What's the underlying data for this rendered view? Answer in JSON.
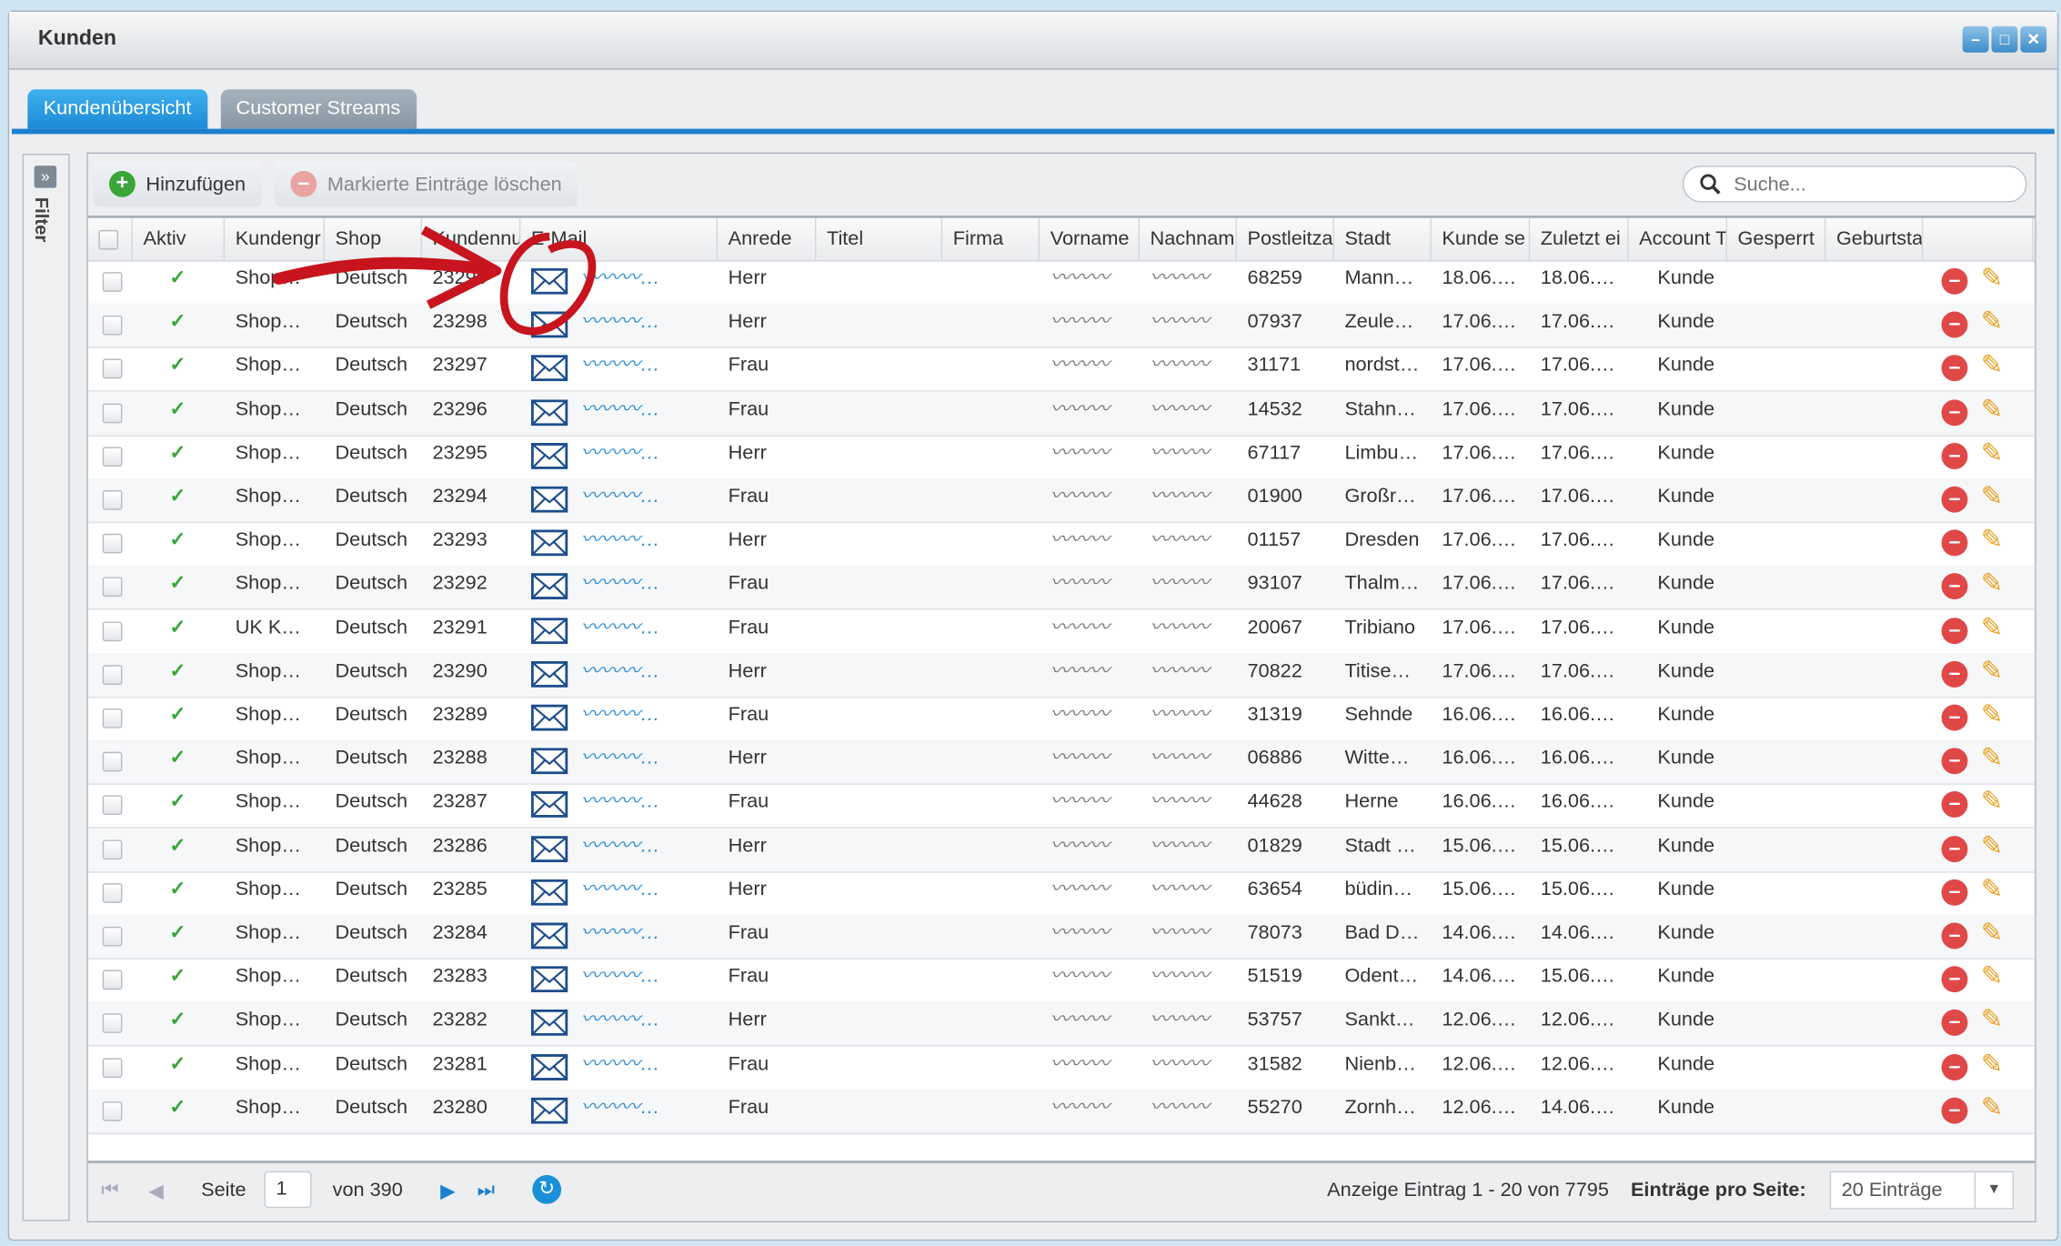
{
  "window": {
    "title": "Kunden",
    "buttons": [
      "minimize",
      "maximize",
      "close"
    ]
  },
  "tabs": [
    {
      "label": "Kundenübersicht",
      "active": true
    },
    {
      "label": "Customer Streams",
      "active": false
    }
  ],
  "filter": {
    "label": "Filter"
  },
  "toolbar": {
    "add_label": "Hinzufügen",
    "delete_label": "Markierte Einträge löschen",
    "search_placeholder": "Suche..."
  },
  "columns": [
    "",
    "Aktiv",
    "Kundengr",
    "Shop",
    "Kundennu",
    "E-Mail",
    "Anrede",
    "Titel",
    "Firma",
    "Vorname",
    "Nachnam",
    "Postleitza",
    "Stadt",
    "Kunde se",
    "Zuletzt ei",
    "Account T",
    "Gesperrt",
    "Geburtsta",
    ""
  ],
  "rows": [
    {
      "group": "Shop…",
      "shop": "Deutsch",
      "nr": "23299",
      "anrede": "Herr",
      "plz": "68259",
      "stadt": "Mann…",
      "seit": "18.06.…",
      "zuletzt": "18.06.…",
      "account": "Kunde"
    },
    {
      "group": "Shop…",
      "shop": "Deutsch",
      "nr": "23298",
      "anrede": "Herr",
      "plz": "07937",
      "stadt": "Zeule…",
      "seit": "17.06.…",
      "zuletzt": "17.06.…",
      "account": "Kunde"
    },
    {
      "group": "Shop…",
      "shop": "Deutsch",
      "nr": "23297",
      "anrede": "Frau",
      "plz": "31171",
      "stadt": "nordst…",
      "seit": "17.06.…",
      "zuletzt": "17.06.…",
      "account": "Kunde"
    },
    {
      "group": "Shop…",
      "shop": "Deutsch",
      "nr": "23296",
      "anrede": "Frau",
      "plz": "14532",
      "stadt": "Stahn…",
      "seit": "17.06.…",
      "zuletzt": "17.06.…",
      "account": "Kunde"
    },
    {
      "group": "Shop…",
      "shop": "Deutsch",
      "nr": "23295",
      "anrede": "Herr",
      "plz": "67117",
      "stadt": "Limbu…",
      "seit": "17.06.…",
      "zuletzt": "17.06.…",
      "account": "Kunde"
    },
    {
      "group": "Shop…",
      "shop": "Deutsch",
      "nr": "23294",
      "anrede": "Frau",
      "plz": "01900",
      "stadt": "Großr…",
      "seit": "17.06.…",
      "zuletzt": "17.06.…",
      "account": "Kunde"
    },
    {
      "group": "Shop…",
      "shop": "Deutsch",
      "nr": "23293",
      "anrede": "Herr",
      "plz": "01157",
      "stadt": "Dresden",
      "seit": "17.06.…",
      "zuletzt": "17.06.…",
      "account": "Kunde"
    },
    {
      "group": "Shop…",
      "shop": "Deutsch",
      "nr": "23292",
      "anrede": "Frau",
      "plz": "93107",
      "stadt": "Thalm…",
      "seit": "17.06.…",
      "zuletzt": "17.06.…",
      "account": "Kunde"
    },
    {
      "group": "UK K…",
      "shop": "Deutsch",
      "nr": "23291",
      "anrede": "Frau",
      "plz": "20067",
      "stadt": "Tribiano",
      "seit": "17.06.…",
      "zuletzt": "17.06.…",
      "account": "Kunde"
    },
    {
      "group": "Shop…",
      "shop": "Deutsch",
      "nr": "23290",
      "anrede": "Herr",
      "plz": "70822",
      "stadt": "Titise…",
      "seit": "17.06.…",
      "zuletzt": "17.06.…",
      "account": "Kunde"
    },
    {
      "group": "Shop…",
      "shop": "Deutsch",
      "nr": "23289",
      "anrede": "Frau",
      "plz": "31319",
      "stadt": "Sehnde",
      "seit": "16.06.…",
      "zuletzt": "16.06.…",
      "account": "Kunde"
    },
    {
      "group": "Shop…",
      "shop": "Deutsch",
      "nr": "23288",
      "anrede": "Herr",
      "plz": "06886",
      "stadt": "Witte…",
      "seit": "16.06.…",
      "zuletzt": "16.06.…",
      "account": "Kunde"
    },
    {
      "group": "Shop…",
      "shop": "Deutsch",
      "nr": "23287",
      "anrede": "Frau",
      "plz": "44628",
      "stadt": "Herne",
      "seit": "16.06.…",
      "zuletzt": "16.06.…",
      "account": "Kunde"
    },
    {
      "group": "Shop…",
      "shop": "Deutsch",
      "nr": "23286",
      "anrede": "Herr",
      "plz": "01829",
      "stadt": "Stadt …",
      "seit": "15.06.…",
      "zuletzt": "15.06.…",
      "account": "Kunde"
    },
    {
      "group": "Shop…",
      "shop": "Deutsch",
      "nr": "23285",
      "anrede": "Herr",
      "plz": "63654",
      "stadt": "büdin…",
      "seit": "15.06.…",
      "zuletzt": "15.06.…",
      "account": "Kunde"
    },
    {
      "group": "Shop…",
      "shop": "Deutsch",
      "nr": "23284",
      "anrede": "Frau",
      "plz": "78073",
      "stadt": "Bad D…",
      "seit": "14.06.…",
      "zuletzt": "14.06.…",
      "account": "Kunde"
    },
    {
      "group": "Shop…",
      "shop": "Deutsch",
      "nr": "23283",
      "anrede": "Frau",
      "plz": "51519",
      "stadt": "Odent…",
      "seit": "14.06.…",
      "zuletzt": "15.06.…",
      "account": "Kunde"
    },
    {
      "group": "Shop…",
      "shop": "Deutsch",
      "nr": "23282",
      "anrede": "Herr",
      "plz": "53757",
      "stadt": "Sankt…",
      "seit": "12.06.…",
      "zuletzt": "12.06.…",
      "account": "Kunde"
    },
    {
      "group": "Shop…",
      "shop": "Deutsch",
      "nr": "23281",
      "anrede": "Frau",
      "plz": "31582",
      "stadt": "Nienb…",
      "seit": "12.06.…",
      "zuletzt": "12.06.…",
      "account": "Kunde"
    },
    {
      "group": "Shop…",
      "shop": "Deutsch",
      "nr": "23280",
      "anrede": "Frau",
      "plz": "55270",
      "stadt": "Zornh…",
      "seit": "12.06.…",
      "zuletzt": "14.06.…",
      "account": "Kunde"
    }
  ],
  "pager": {
    "page_label": "Seite",
    "page": "1",
    "of_label": "von 390",
    "summary": "Anzeige Eintrag 1 - 20 von 7795",
    "per_page_label": "Einträge pro Seite:",
    "per_page_value": "20 Einträge"
  },
  "colors": {
    "accent": "#1a7fd0",
    "check": "#3aa63a",
    "delete": "#e04848",
    "edit": "#e8a020",
    "annotation": "#c8141e"
  }
}
